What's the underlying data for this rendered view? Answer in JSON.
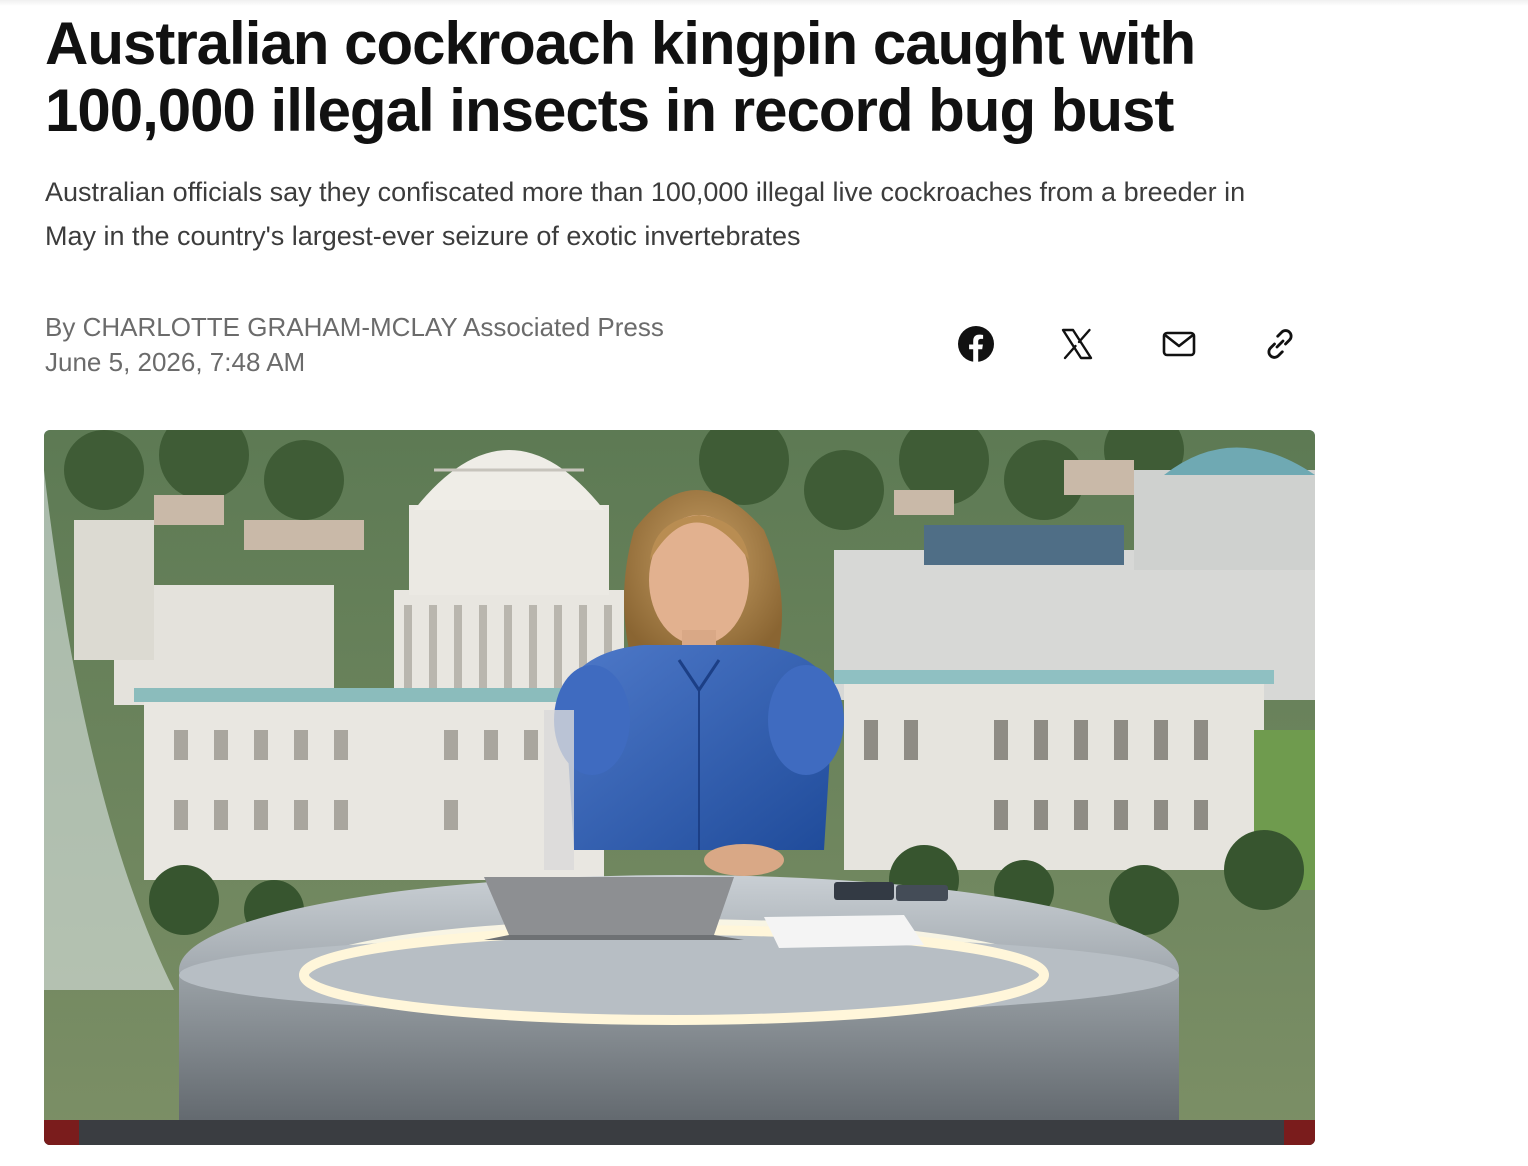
{
  "article": {
    "headline": "Australian cockroach kingpin caught with 100,000 illegal insects in record bug bust",
    "summary": "Australian officials say they confiscated more than 100,000 illegal live cockroaches from a breeder in May in the country's largest-ever seizure of exotic invertebrates",
    "byline": "By CHARLOTTE GRAHAM-MCLAY Associated Press",
    "date": "June 5, 2026, 7:48 AM"
  },
  "share": {
    "icons": [
      "facebook-icon",
      "x-icon",
      "mail-icon",
      "link-icon"
    ],
    "icon_color": "#111111"
  },
  "hero_image": {
    "content": "news anchor at studio desk with U.S. Capitol backdrop"
  }
}
